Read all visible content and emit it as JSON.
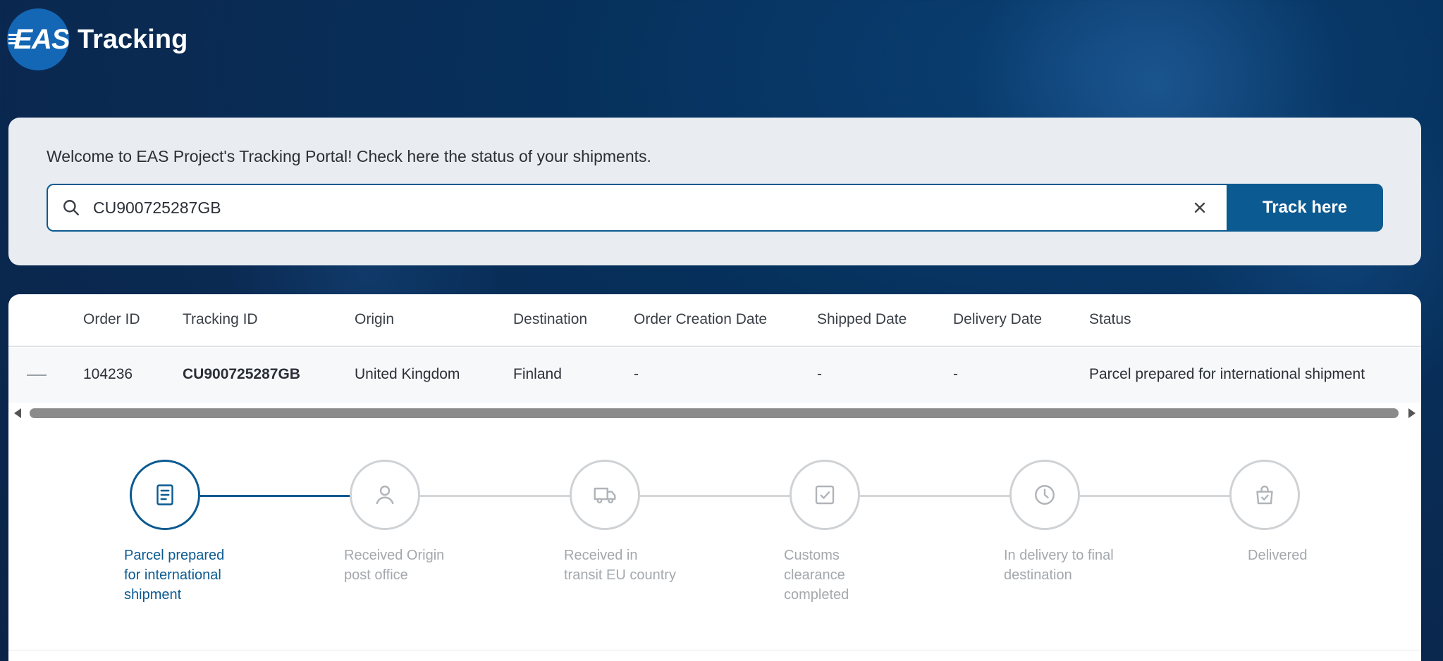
{
  "header": {
    "logo_text": "EAS",
    "title": "Tracking"
  },
  "search": {
    "welcome": "Welcome to EAS Project's Tracking Portal! Check here the status of your shipments.",
    "value": "CU900725287GB",
    "button_label": "Track here"
  },
  "table": {
    "columns": [
      "Order ID",
      "Tracking ID",
      "Origin",
      "Destination",
      "Order Creation Date",
      "Shipped Date",
      "Delivery Date",
      "Status"
    ],
    "row": {
      "order_id": "104236",
      "tracking_id": "CU900725287GB",
      "origin": "United Kingdom",
      "destination": "Finland",
      "order_creation_date": "-",
      "shipped_date": "-",
      "delivery_date": "-",
      "status": "Parcel prepared for international shipment"
    }
  },
  "steps": [
    {
      "label": "Parcel prepared for international shipment",
      "icon": "document-icon",
      "active": true
    },
    {
      "label": "Received Origin post office",
      "icon": "person-icon",
      "active": false
    },
    {
      "label": "Received in transit EU country",
      "icon": "truck-icon",
      "active": false
    },
    {
      "label": "Customs clearance completed",
      "icon": "checkbox-icon",
      "active": false
    },
    {
      "label": "In delivery to final destination",
      "icon": "clock-icon",
      "active": false
    },
    {
      "label": "Delivered",
      "icon": "bag-check-icon",
      "active": false
    }
  ],
  "colors": {
    "accent": "#0b5a91",
    "inactive": "#cfd2d5",
    "logo": "#1467b5"
  }
}
